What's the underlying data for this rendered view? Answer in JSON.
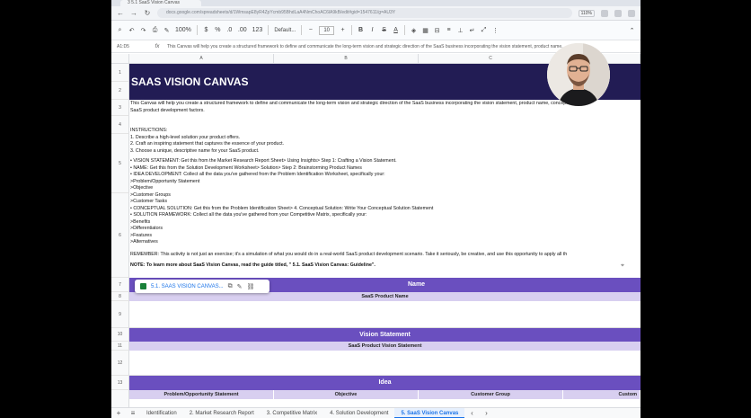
{
  "browser": {
    "tab_title": "3 5.1 SaaS Vision Canvas",
    "url": "docs.google.com/spreadsheets/d/1WmsapE8yR4ZpYcmb95BhdLaA4NmChoAC6lA9kB/edit#gid=1547611/g=AU3Y",
    "zoom_badge": "110%",
    "back_icon": "back-arrow-icon",
    "forward_icon": "forward-arrow-icon",
    "reload_icon": "reload-icon"
  },
  "toolbar": {
    "zoom": "100%",
    "currency": "$",
    "percent": "%",
    "decimal_down": ".0",
    "decimal_up": ".00",
    "number_format": "123",
    "font": "Default...",
    "font_size": "10",
    "bold": "B",
    "italic": "I",
    "strike": "S",
    "text_color": "A"
  },
  "formula_bar": {
    "name_box": "A1:D5",
    "fx": "fx",
    "content": "This Canvas will help you create a structured framework to define and communicate the long-term vision and strategic direction of the SaaS business incorporating the vision statement, product name,"
  },
  "columns": [
    "A",
    "B",
    "C"
  ],
  "rows": [
    {
      "num": "1"
    },
    {
      "num": "2"
    },
    {
      "num": "3"
    },
    {
      "num": "4"
    },
    {
      "num": "5"
    },
    {
      "num": "6"
    },
    {
      "num": "7"
    },
    {
      "num": "8"
    },
    {
      "num": "9"
    },
    {
      "num": "10"
    },
    {
      "num": "11"
    },
    {
      "num": "12"
    },
    {
      "num": "13"
    }
  ],
  "sheet": {
    "title": "SAAS VISION CANVAS",
    "intro": [
      "This Canvas will help you create a structured framework to define and communicate the long-term vision and strategic direction of the SaaS business incorporating the vision statement, product name, conceptu",
      "SaaS product development factors."
    ],
    "instructions_title": "INSTRUCTIONS:",
    "instructions": [
      "  1. Describe a high-level solution your product offers.",
      "  2. Craft an inspiring statement that captures the essence of your product.",
      "  3. Choose a unique, descriptive name for your SaaS product.",
      "",
      "  • VISION STATEMENT: Get this from the Market Research Report Sheet> Using Insights> Step 1: Crafting a Vision Statement.",
      "  • NAME: Get this from the Solution Development Worksheet> Solution> Step 2: Brainstorming Product Names",
      "  • IDEA DEVELOPMENT: Collect all the data you've gathered from the Problem Identification Worksheet, specifically your:",
      "     >Problem/Opportunity Statement",
      "     >Objective",
      "     >Customer Groups",
      "     >Customer Tasks",
      "  • CONCEPTUAL SOLUTION: Get this from the Problem Identification Sheet> 4. Conceptual Solution: Write Your Conceptual Solution Statement",
      "  • SOLUTION FRAMEWORK: Collect all the data you've gathered from your Competitive Matrix, specifically your:",
      "     >Benefits",
      "     >Differentiators",
      "     >Features",
      "     >Alternatives"
    ],
    "remember": "REMEMBER: This activity is not just an exercise; it's a simulation of what you would do in a real-world SaaS product development scenario. Take it seriously, be creative, and use this opportunity to apply all th",
    "note": "NOTE: To learn more about SaaS Vision Canvas, read the guide titled, \" 5.1. SaaS Vision Canvas: Guideline\".",
    "chip_label": "5.1. SAAS VISION CANVAS...",
    "name_section": "Name",
    "name_sub": "SaaS Product Name",
    "vision_section": "Vision Statement",
    "vision_sub": "SaaS Product Vision Statement",
    "idea_section": "Idea",
    "idea_headers": [
      "Problem/Opportunity Statement",
      "Objective",
      "Customer Group",
      "Custom"
    ]
  },
  "sheet_tabs": [
    "Identification",
    "2. Market Research Report",
    "3. Competitive Matrix",
    "4. Solution Development",
    "5. SaaS Vision Canvas"
  ],
  "colors": {
    "title_band": "#221c54",
    "section_purple": "#6a4fbf",
    "section_light": "#d8cff0"
  }
}
